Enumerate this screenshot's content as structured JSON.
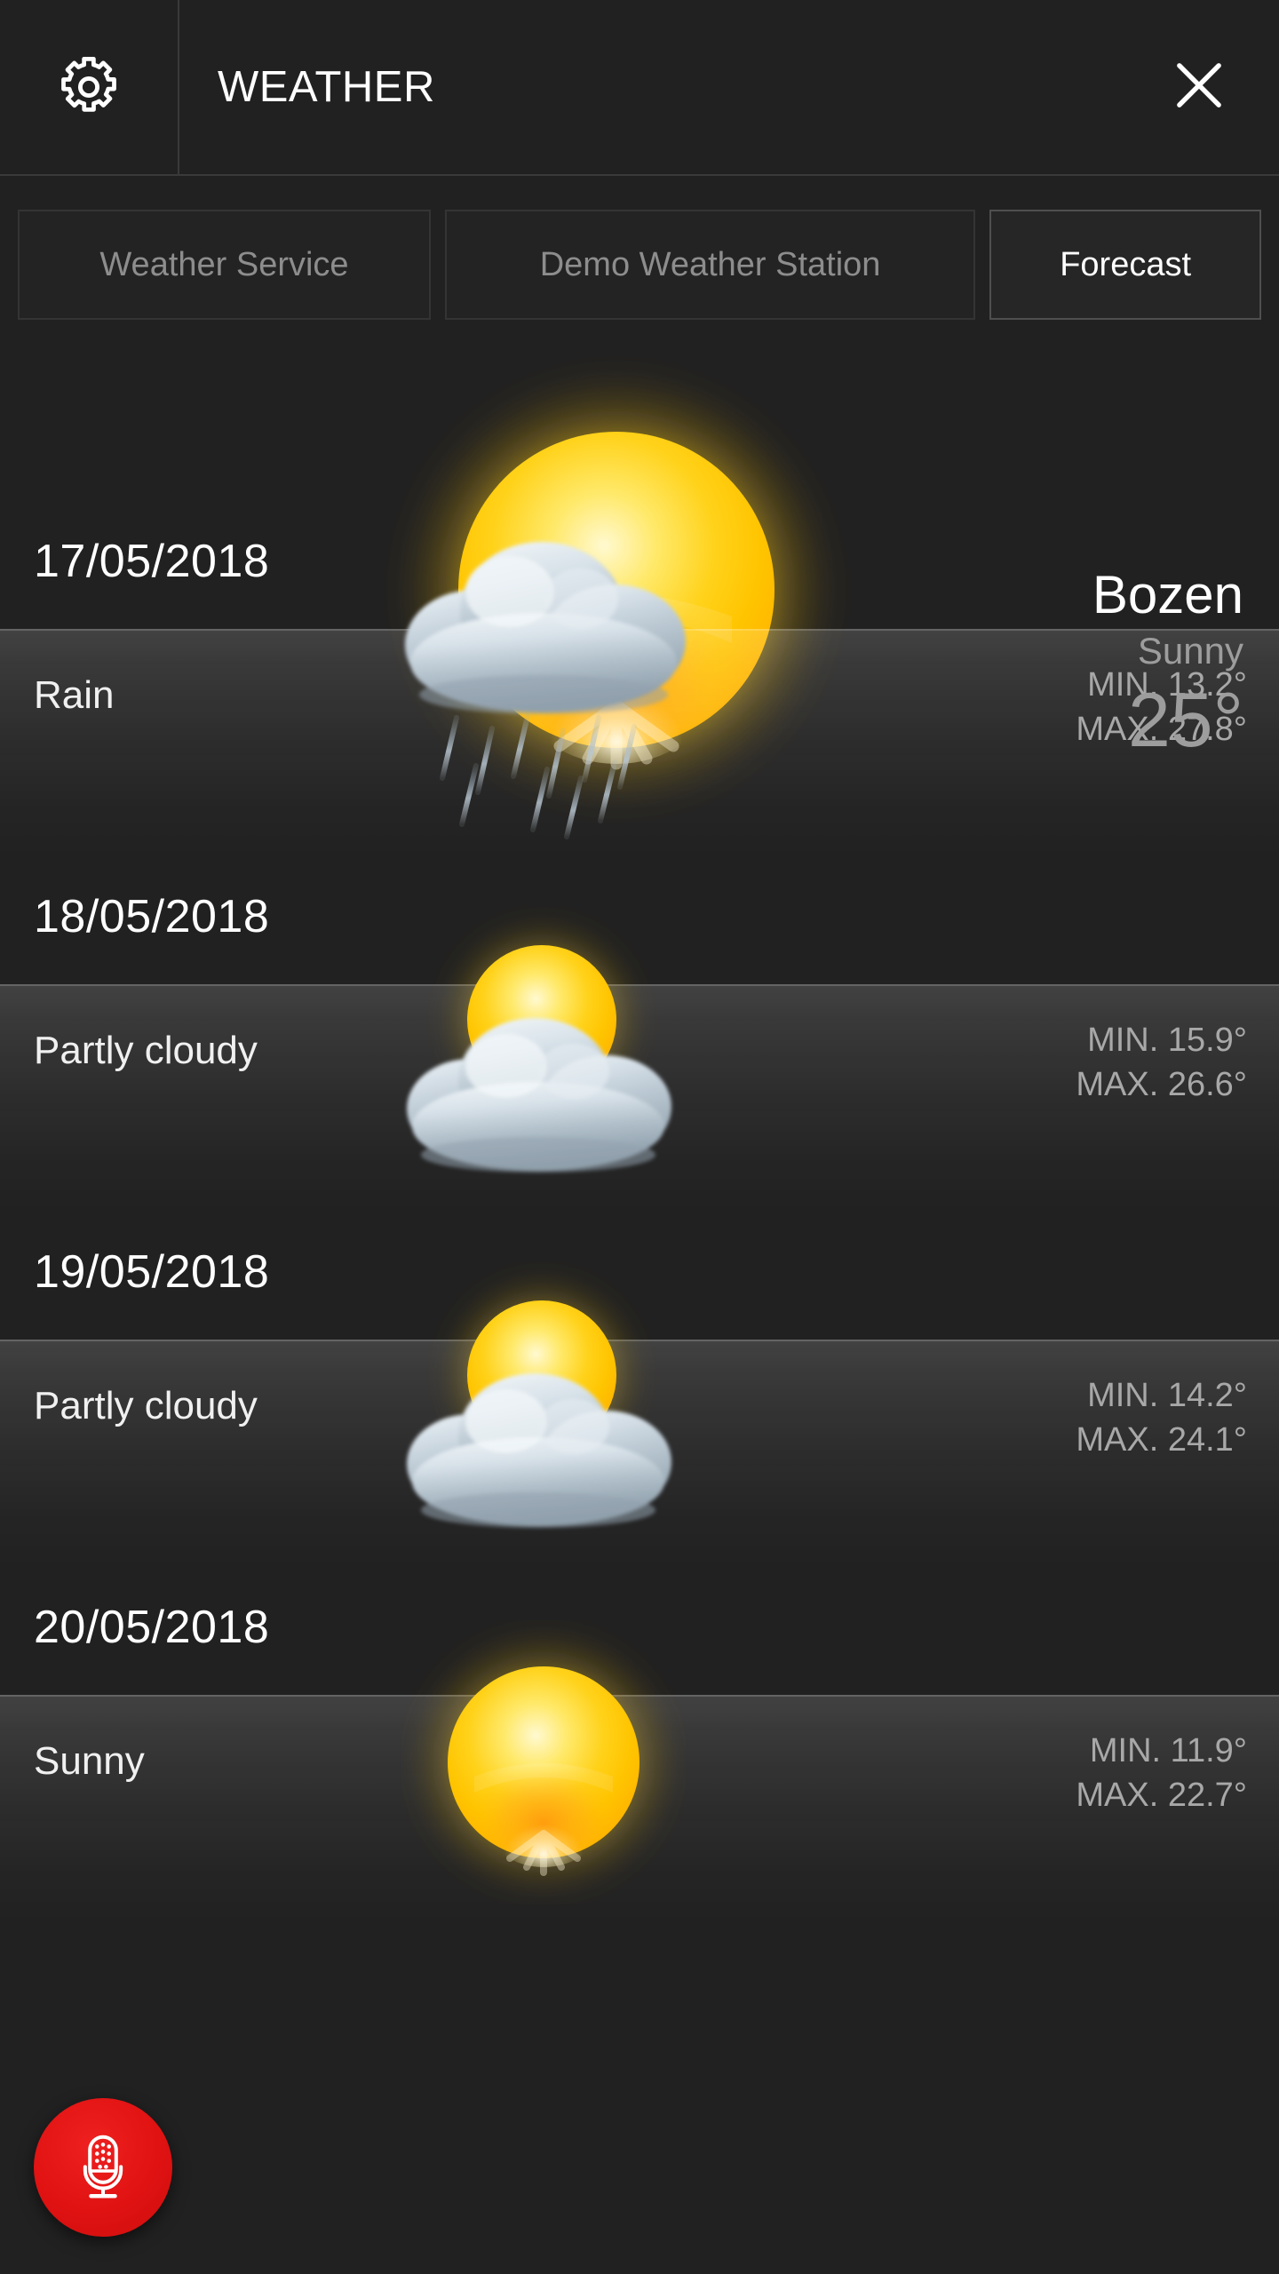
{
  "window": {
    "title": "WEATHER",
    "settings_icon": "gear-icon",
    "close_icon": "close-icon"
  },
  "tabs": [
    {
      "label": "Weather Service",
      "active": false
    },
    {
      "label": "Demo Weather Station",
      "active": false
    },
    {
      "label": "Forecast",
      "active": true
    }
  ],
  "current": {
    "city": "Bozen",
    "condition": "Sunny",
    "temperature": "25°",
    "icon": "sun-icon"
  },
  "forecast": [
    {
      "date": "17/05/2018",
      "condition": "Rain",
      "min": "MIN. 13.2°",
      "max": "MAX. 27.8°",
      "icon": "rain-cloud-icon"
    },
    {
      "date": "18/05/2018",
      "condition": "Partly cloudy",
      "min": "MIN. 15.9°",
      "max": "MAX. 26.6°",
      "icon": "sun-behind-cloud-icon"
    },
    {
      "date": "19/05/2018",
      "condition": "Partly cloudy",
      "min": "MIN. 14.2°",
      "max": "MAX. 24.1°",
      "icon": "sun-behind-cloud-icon"
    },
    {
      "date": "20/05/2018",
      "condition": "Sunny",
      "min": "MIN. 11.9°",
      "max": "MAX. 22.7°",
      "icon": "sun-icon"
    }
  ],
  "voice_button": {
    "icon": "microphone-icon",
    "color": "#e01212"
  },
  "colors": {
    "background": "#212121",
    "header_border": "#3a3a3a",
    "tab_inactive_text": "#8d8d8d",
    "tab_active_text": "#ffffff",
    "primary_text": "#ffffff",
    "secondary_text": "#a8a8a8",
    "accent_red": "#e01212",
    "sun_yellow": "#ffd400",
    "sun_orange": "#ff9500",
    "cloud_gray": "#b9c4cc"
  }
}
